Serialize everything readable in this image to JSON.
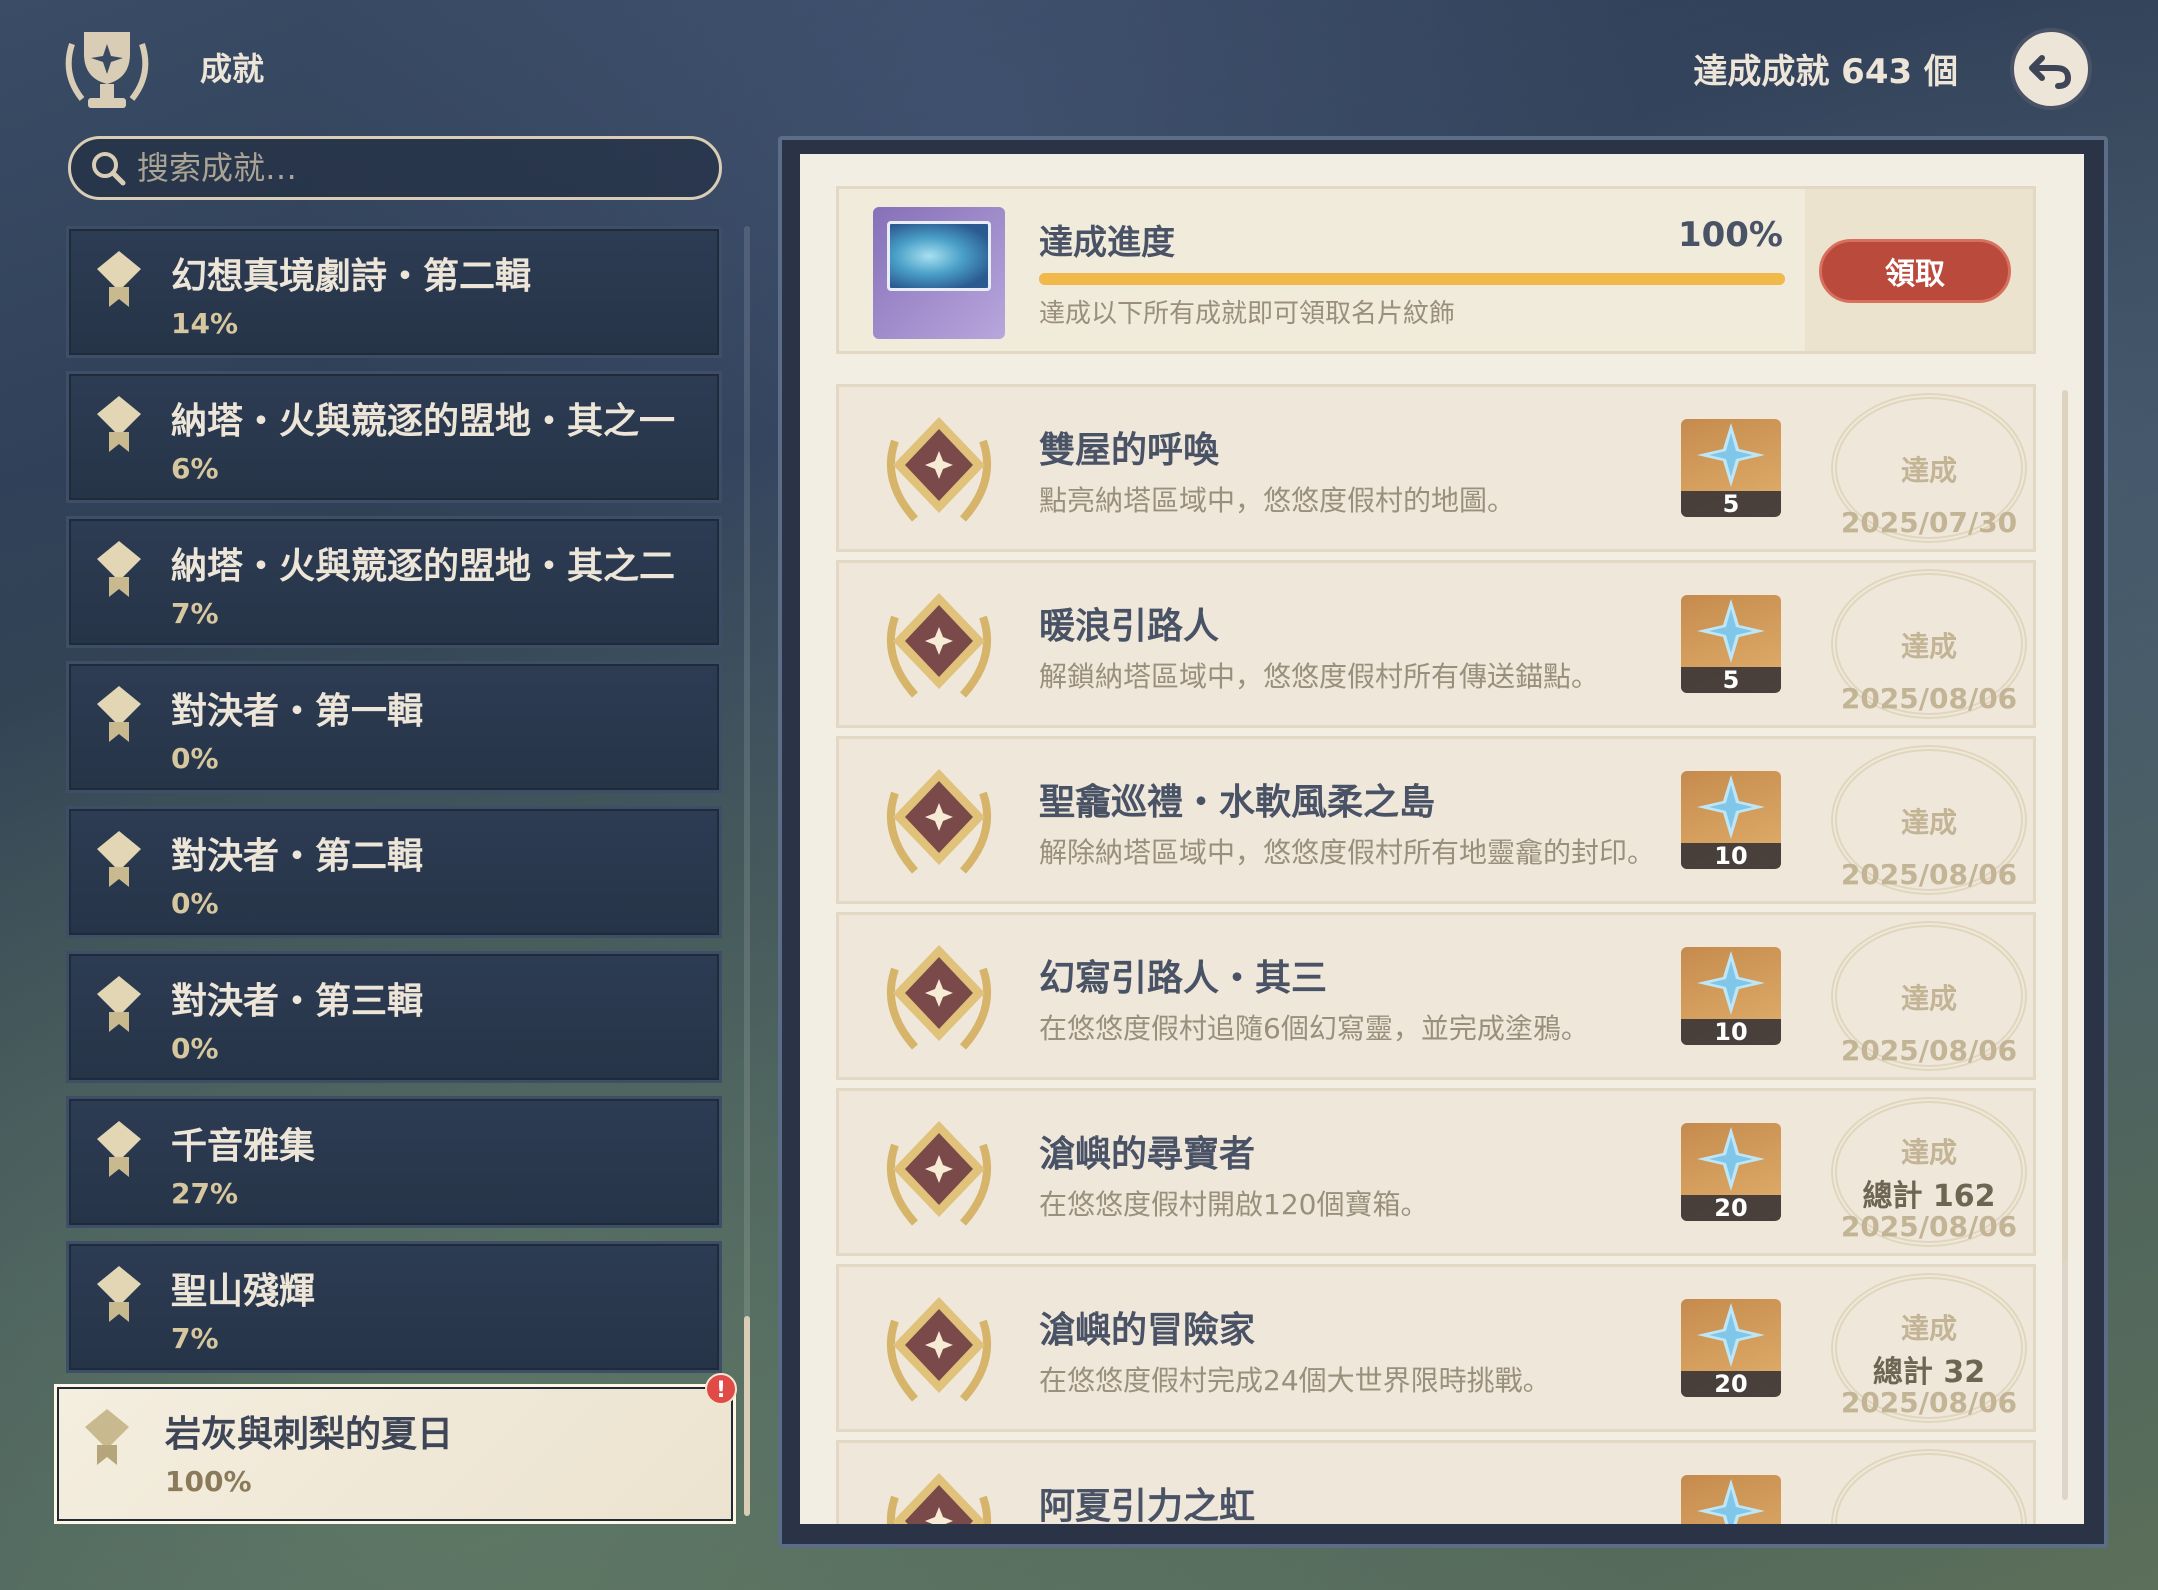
{
  "header": {
    "title": "成就",
    "achieved_count": "達成成就 643 個"
  },
  "search": {
    "placeholder": "搜索成就…"
  },
  "categories": [
    {
      "name": "幻想真境劇詩・第二輯",
      "percent": "14%"
    },
    {
      "name": "納塔・火與競逐的盟地・其之一",
      "percent": "6%"
    },
    {
      "name": "納塔・火與競逐的盟地・其之二",
      "percent": "7%"
    },
    {
      "name": "對決者・第一輯",
      "percent": "0%"
    },
    {
      "name": "對決者・第二輯",
      "percent": "0%"
    },
    {
      "name": "對決者・第三輯",
      "percent": "0%"
    },
    {
      "name": "千音雅集",
      "percent": "27%"
    },
    {
      "name": "聖山殘輝",
      "percent": "7%"
    },
    {
      "name": "岩灰與刺梨的夏日",
      "percent": "100%",
      "selected": true,
      "badge": "!"
    }
  ],
  "progress": {
    "title": "達成進度",
    "percent": "100%",
    "value": 1.0,
    "description": "達成以下所有成就即可領取名片紋飾",
    "claim_label": "領取"
  },
  "achievements": [
    {
      "title": "雙屋的呼喚",
      "desc": "點亮納塔區域中，悠悠度假村的地圖。",
      "reward": "5",
      "status": "達成",
      "total": "",
      "date": "2025/07/30"
    },
    {
      "title": "暖浪引路人",
      "desc": "解鎖納塔區域中，悠悠度假村所有傳送錨點。",
      "reward": "5",
      "status": "達成",
      "total": "",
      "date": "2025/08/06"
    },
    {
      "title": "聖龕巡禮・水軟風柔之島",
      "desc": "解除納塔區域中，悠悠度假村所有地靈龕的封印。",
      "reward": "10",
      "status": "達成",
      "total": "",
      "date": "2025/08/06"
    },
    {
      "title": "幻寫引路人・其三",
      "desc": "在悠悠度假村追隨6個幻寫靈，並完成塗鴉。",
      "reward": "10",
      "status": "達成",
      "total": "",
      "date": "2025/08/06"
    },
    {
      "title": "滄嶼的尋寶者",
      "desc": "在悠悠度假村開啟120個寶箱。",
      "reward": "20",
      "status": "達成",
      "total": "總計 162",
      "date": "2025/08/06"
    },
    {
      "title": "滄嶼的冒險家",
      "desc": "在悠悠度假村完成24個大世界限時挑戰。",
      "reward": "20",
      "status": "達成",
      "total": "總計 32",
      "date": "2025/08/06"
    },
    {
      "title": "阿夏引力之虹",
      "desc": "",
      "reward": "",
      "status": "",
      "total": "",
      "date": ""
    }
  ],
  "colors": {
    "accent_gold": "#f0b94a",
    "claim_red": "#b94a3c",
    "panel_bg": "#f3eee3",
    "category_bg": "#2d3c53"
  }
}
